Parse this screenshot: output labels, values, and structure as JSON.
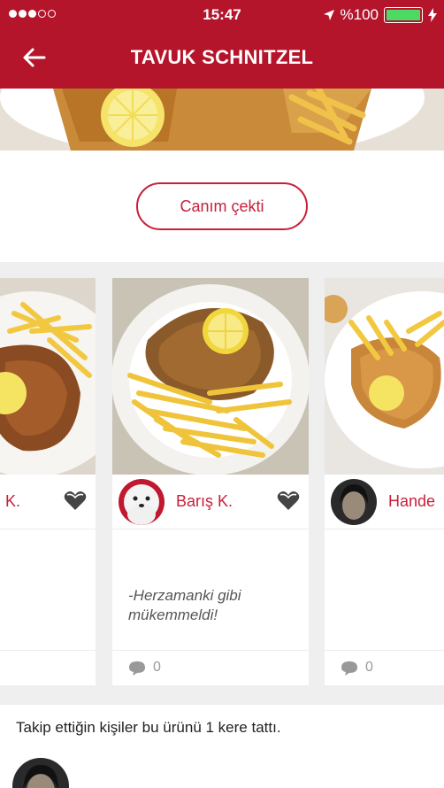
{
  "status_bar": {
    "time": "15:47",
    "battery_text": "%100",
    "battery_level": 1.0,
    "signal_dots_filled": 3,
    "signal_dots_total": 5
  },
  "header": {
    "title": "TAVUK SCHNITZEL",
    "back_icon": "arrow-left-icon"
  },
  "actions": {
    "crave_label": "Canım çekti"
  },
  "reviews": [
    {
      "user": "K.",
      "comment": "",
      "comment_count": ""
    },
    {
      "user": "Barış K.",
      "comment": "-Herzamanki gibi mükemmeldi!",
      "comment_count": "0"
    },
    {
      "user": "Hande",
      "comment": "",
      "comment_count": "0"
    }
  ],
  "followers": {
    "summary": "Takip ettiğin kişiler bu ürünü 1 kere tattı."
  },
  "colors": {
    "brand": "#b5152b",
    "accent": "#c8203a",
    "battery": "#4cd964"
  }
}
